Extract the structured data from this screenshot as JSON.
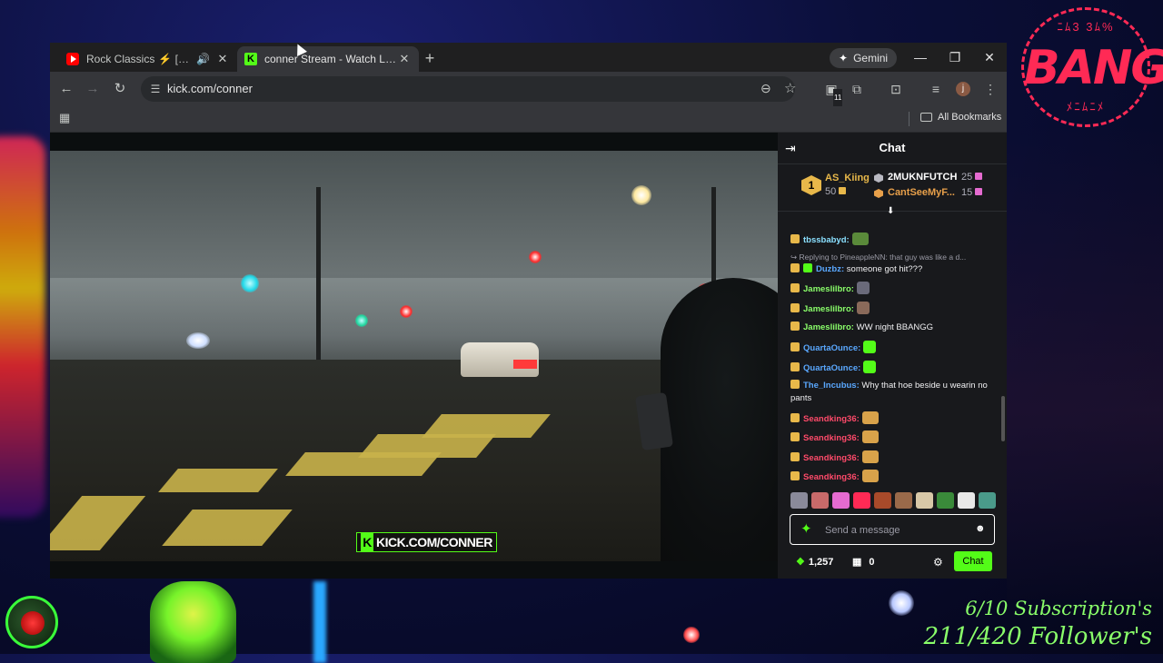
{
  "overlay": {
    "badge_text": "BANG",
    "badge_top": "ﾆﾑ3 3ﾑ%",
    "badge_bottom": "ﾒﾆﾑﾆﾒ",
    "subs": "6/10 Subscription's",
    "followers": "211/420 Follower's"
  },
  "browser": {
    "tabs": [
      {
        "title": "Rock Classics",
        "suffix": "[ LIVE ] Ti",
        "icon": "youtube-icon",
        "audio": true
      },
      {
        "title": "conner Stream - Watch Live on",
        "icon": "kick-icon",
        "active": true
      }
    ],
    "gemini_label": "Gemini",
    "url": "kick.com/conner",
    "ext_badge": "11",
    "profile_initial": "j",
    "all_bookmarks": "All Bookmarks"
  },
  "video": {
    "watermark": "KICK.COM/CONNER"
  },
  "chat": {
    "title": "Chat",
    "leaderboard": [
      {
        "rank": "1",
        "name": "AS_Kiing",
        "value": "50",
        "color": "#e8b84a"
      },
      {
        "name": "2MUKNFUTCH",
        "value": "25",
        "color": "#ffffff"
      },
      {
        "name": "CantSeeMyF...",
        "value": "15",
        "color": "#e8a04a"
      }
    ],
    "messages": [
      {
        "user": "tbssbabyd:",
        "text": "",
        "color": "#8ae0ff"
      },
      {
        "reply": "Replying to PineappleNN: that guy was like a d..."
      },
      {
        "user": "Duzbz:",
        "text": "someone got hit???",
        "color": "#5aa8ff"
      },
      {
        "user": "Jameslilbro:",
        "text": "",
        "color": "#8aff6a"
      },
      {
        "user": "Jameslilbro:",
        "text": "",
        "color": "#8aff6a"
      },
      {
        "user": "Jameslilbro:",
        "text": "WW night BBANGG",
        "color": "#8aff6a"
      },
      {
        "user": "QuartaOunce:",
        "text": "",
        "color": "#5aa8ff"
      },
      {
        "user": "QuartaOunce:",
        "text": "",
        "color": "#5aa8ff"
      },
      {
        "user": "The_Incubus:",
        "text": "Why that hoe beside u wearin no pants",
        "color": "#5aa8ff"
      },
      {
        "user": "Seandking36:",
        "text": "",
        "color": "#ff4a6a"
      },
      {
        "user": "Seandking36:",
        "text": "",
        "color": "#ff4a6a"
      },
      {
        "user": "Seandking36:",
        "text": "",
        "color": "#ff4a6a"
      },
      {
        "user": "Seandking36:",
        "text": "",
        "color": "#ff4a6a"
      }
    ],
    "input_placeholder": "Send a message",
    "points": "1,257",
    "store_count": "0",
    "send_label": "Chat"
  },
  "colors": {
    "kick_green": "#53fc18",
    "bang_pink": "#ff2a55",
    "overlay_green": "#8aff6a"
  }
}
